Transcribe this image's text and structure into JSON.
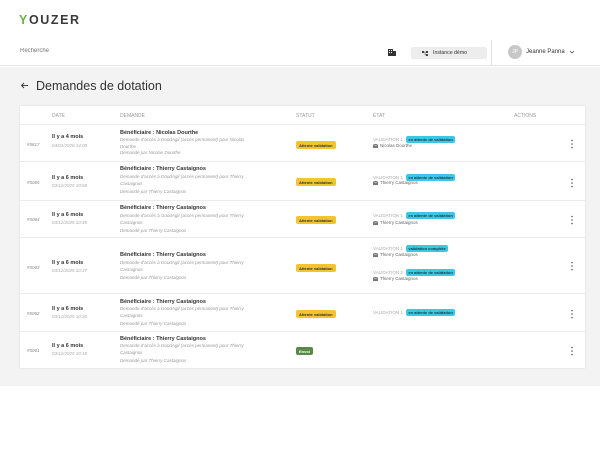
{
  "app": {
    "logo_y": "Y",
    "logo_rest": "OUZER"
  },
  "search": {
    "placeholder": "Recherche"
  },
  "instance_button": {
    "label": "Instance démo"
  },
  "user": {
    "initials": "JP",
    "name": "Jeanne Panna"
  },
  "page": {
    "title": "Demandes de dotation"
  },
  "table": {
    "headers": {
      "date": "DATE",
      "demande": "DEMANDE",
      "statut": "STATUT",
      "etat": "ÉTAT",
      "actions": "ACTIONS"
    },
    "rows": [
      {
        "id": "#5817",
        "date_rel": "Il y a 4 mois",
        "date_abs": "04/02/2026 14:08",
        "beneficiaire": "Bénéficiaire : Nicolas Dourthe",
        "desc": "Demande d'accès à GoodAgil (accès permanent) pour Nicolas Dourthe",
        "by": "Demandé par Nicolas Dourthe",
        "status": "Attente validation",
        "validations": [
          {
            "label": "VALIDATION 1",
            "state": "en attente de validation",
            "user": "Nicolas Dourthe"
          }
        ]
      },
      {
        "id": "#5065",
        "date_rel": "Il y a 6 mois",
        "date_abs": "03/12/2025 10:58",
        "beneficiaire": "Bénéficiaire : Thierry Castaignos",
        "desc": "Demande d'accès à GoodAgil (accès permanent) pour Thierry Castaignos",
        "by": "Demandé par Thierry Castaignos",
        "status": "Attente validation",
        "validations": [
          {
            "label": "VALIDATION 1",
            "state": "en attente de validation",
            "user": "Thierry Castaignos"
          }
        ]
      },
      {
        "id": "#5064",
        "date_rel": "Il y a 6 mois",
        "date_abs": "03/12/2025 10:46",
        "beneficiaire": "Bénéficiaire : Thierry Castaignos",
        "desc": "Demande d'accès à GoodAgil (accès permanent) pour Thierry Castaignos",
        "by": "Demandé par Thierry Castaignos",
        "status": "Attente validation",
        "validations": [
          {
            "label": "VALIDATION 1",
            "state": "en attente de validation",
            "user": "Thierry Castaignos"
          }
        ]
      },
      {
        "id": "#5063",
        "date_rel": "Il y a 6 mois",
        "date_abs": "03/12/2025 10:37",
        "beneficiaire": "Bénéficiaire : Thierry Castaignos",
        "desc": "Demande d'accès à GoodAgil (accès permanent) pour Thierry Castaignos",
        "by": "Demandé par Thierry Castaignos",
        "status": "Attente validation",
        "validations": [
          {
            "label": "VALIDATION 1",
            "state": "validation complète",
            "user": "Thierry Castaignos"
          },
          {
            "label": "VALIDATION 2",
            "state": "en attente de validation",
            "user": "Thierry Castaignos"
          }
        ]
      },
      {
        "id": "#5062",
        "date_rel": "Il y a 6 mois",
        "date_abs": "03/12/2025 10:30",
        "beneficiaire": "Bénéficiaire : Thierry Castaignos",
        "desc": "Demande d'accès à GoodAgil (accès permanent) pour Thierry Castaignos",
        "by": "Demandé par Thierry Castaignos",
        "status": "Attente validation",
        "validations": [
          {
            "label": "VALIDATION 1",
            "state": "en attente de validation",
            "user": ""
          }
        ]
      },
      {
        "id": "#5061",
        "date_rel": "Il y a 6 mois",
        "date_abs": "03/12/2025 10:18",
        "beneficiaire": "Bénéficiaire : Thierry Castaignos",
        "desc": "Demande d'accès à GoodAgil (accès permanent) pour Thierry Castaignos",
        "by": "Demandé par Thierry Castaignos",
        "status": "Envoi",
        "validations": []
      }
    ]
  }
}
